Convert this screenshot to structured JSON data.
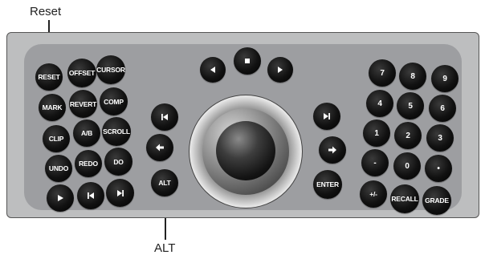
{
  "callouts": {
    "reset": "Reset",
    "alt": "ALT"
  },
  "left_keys": {
    "reset": "RESET",
    "offset": "OFFSET",
    "cursor": "CURSOR",
    "mark": "MARK",
    "revert": "REVERT",
    "comp": "COMP",
    "clip": "CLIP",
    "ab": "A/B",
    "scroll": "SCROLL",
    "undo": "UNDO",
    "redo": "REDO",
    "do": "DO"
  },
  "center_keys": {
    "alt": "ALT",
    "enter": "ENTER"
  },
  "numpad": {
    "k7": "7",
    "k8": "8",
    "k9": "9",
    "k4": "4",
    "k5": "5",
    "k6": "6",
    "k1": "1",
    "k2": "2",
    "k3": "3",
    "minus": "-",
    "k0": "0",
    "dot": "•",
    "plusminus": "+/-",
    "recall": "RECALL",
    "grade": "GRADE"
  },
  "icons": {
    "play": "play-icon",
    "prev": "skip-previous-icon",
    "next": "skip-next-icon",
    "stop": "stop-icon",
    "left_arrow": "arrow-left-icon",
    "right_arrow": "arrow-right-icon"
  },
  "colors": {
    "panel_outer": "#bdbebf",
    "panel_inner": "#9d9ea1",
    "key": "#111111",
    "key_text": "#ffffff"
  }
}
